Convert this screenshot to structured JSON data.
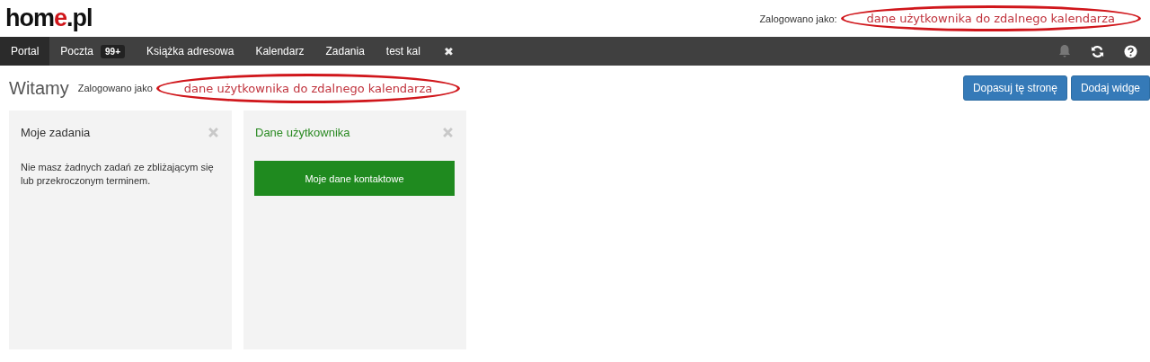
{
  "header": {
    "logo": {
      "main": "hom",
      "accent": "e",
      "rest": ".pl"
    },
    "login_label": "Zalogowano jako:",
    "annotation": "dane użytkownika do zdalnego kalendarza"
  },
  "nav": {
    "tabs": [
      {
        "label": "Portal",
        "selected": true
      },
      {
        "label": "Poczta",
        "badge": "99+",
        "selected": false
      },
      {
        "label": "Książka adresowa",
        "selected": false
      },
      {
        "label": "Kalendarz",
        "selected": false
      },
      {
        "label": "Zadania",
        "selected": false
      },
      {
        "label": "test kal",
        "selected": false
      },
      {
        "label": "✖",
        "kind": "close",
        "selected": false
      }
    ]
  },
  "welcome": {
    "title": "Witamy",
    "login_label": "Zalogowano jako",
    "annotation": "dane użytkownika do zdalnego kalendarza",
    "buttons": [
      "Dopasuj tę stronę",
      "Dodaj widge"
    ]
  },
  "widgets": [
    {
      "title": "Moje zadania",
      "kind": "text",
      "body": "Nie masz żadnych zadań ze zbliżającym się lub przekroczonym terminem."
    },
    {
      "title": "Dane użytkownika",
      "kind": "action",
      "body": "Moje dane kontaktowe"
    }
  ]
}
